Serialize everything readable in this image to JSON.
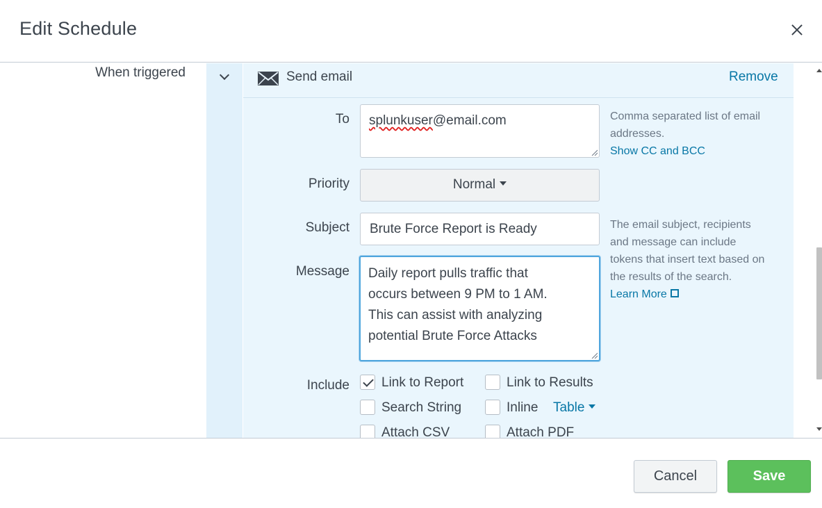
{
  "dialog": {
    "title": "Edit Schedule"
  },
  "trigger": {
    "label": "When triggered"
  },
  "action": {
    "title": "Send email",
    "remove_label": "Remove"
  },
  "form": {
    "to": {
      "label": "To",
      "value_user": "splunkuser",
      "value_domain": "@email.com"
    },
    "to_help": {
      "line1": "Comma separated list of email",
      "line2": "addresses.",
      "cc_link": "Show CC and BCC"
    },
    "priority": {
      "label": "Priority",
      "value": "Normal"
    },
    "subject": {
      "label": "Subject",
      "value": "Brute Force Report is Ready"
    },
    "subject_help": {
      "line1": "The email subject, recipients",
      "line2": "and message can include",
      "line3": "tokens that insert text based on",
      "line4": "the results of the search.",
      "learn_more": "Learn More"
    },
    "message": {
      "label": "Message",
      "line1": "Daily report pulls traffic that",
      "line2": "occurs between 9 PM to 1 AM.",
      "line3": "This can assist with analyzing",
      "line4": "potential Brute Force Attacks"
    },
    "include": {
      "label": "Include",
      "link_to_report": {
        "label": "Link to Report",
        "checked": true
      },
      "link_to_results": {
        "label": "Link to Results",
        "checked": false
      },
      "search_string": {
        "label": "Search String",
        "checked": false
      },
      "inline": {
        "label": "Inline",
        "checked": false,
        "format": "Table"
      },
      "attach_csv": {
        "label": "Attach CSV",
        "checked": false
      },
      "attach_pdf": {
        "label": "Attach PDF",
        "checked": false
      }
    }
  },
  "footer": {
    "cancel_label": "Cancel",
    "save_label": "Save"
  },
  "colors": {
    "accent_link": "#0877a6",
    "save_green": "#5cc05c",
    "panel_bg": "#eaf6fd",
    "focus_border": "#4fa6dd"
  }
}
